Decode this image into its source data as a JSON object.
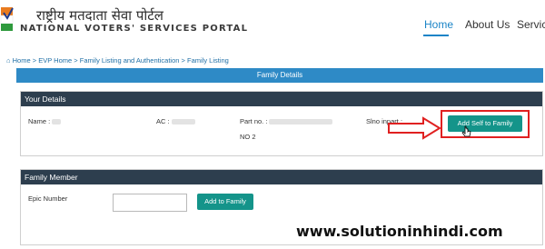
{
  "header": {
    "title_hindi": "राष्ट्रीय मतदाता सेवा पोर्टल",
    "title_english": "NATIONAL VOTERS' SERVICES PORTAL",
    "nav": [
      "Home",
      "About Us",
      "Service"
    ]
  },
  "breadcrumb": {
    "home_icon": "home-icon",
    "items": [
      "Home",
      "EVP Home",
      "Family Listing and Authentication",
      "Family Listing"
    ],
    "separator": ">"
  },
  "banner": {
    "title": "Family Details"
  },
  "your_details": {
    "heading": "Your Details",
    "name_label": "Name :",
    "ac_label": "AC :",
    "part_label": "Part no. :",
    "part_value": "NO 2",
    "slno_label": "Slno inpart :",
    "add_self_button": "Add Self to Family"
  },
  "family_member": {
    "heading": "Family Member",
    "epic_label": "Epic Number",
    "epic_value": "",
    "add_button": "Add to Family"
  },
  "watermark": "www.solutioninhindi.com",
  "colors": {
    "accent": "#2e8ac6",
    "panel_header": "#2d3e4e",
    "button": "#14948a",
    "highlight": "#e02020"
  }
}
